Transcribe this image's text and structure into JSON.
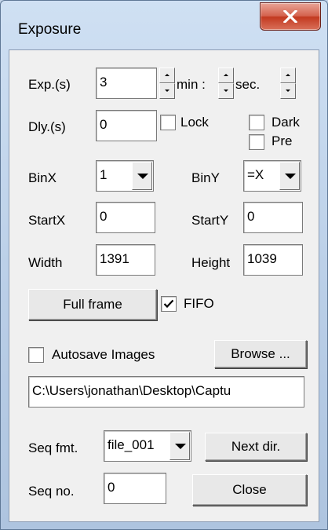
{
  "window": {
    "title": "Exposure",
    "close_glyph": "X"
  },
  "exposure": {
    "label": "Exp.(s)",
    "value": "3",
    "min_label": "min :",
    "sec_label": "sec."
  },
  "delay": {
    "label": "Dly.(s)",
    "value": "0"
  },
  "lock": {
    "label": "Lock",
    "checked": false
  },
  "dark": {
    "label": "Dark",
    "checked": false
  },
  "pre": {
    "label": "Pre",
    "checked": false
  },
  "binx": {
    "label": "BinX",
    "value": "1"
  },
  "biny": {
    "label": "BinY",
    "value": "=X"
  },
  "startx": {
    "label": "StartX",
    "value": "0"
  },
  "starty": {
    "label": "StartY",
    "value": "0"
  },
  "width": {
    "label": "Width",
    "value": "1391"
  },
  "height": {
    "label": "Height",
    "value": "1039"
  },
  "full_frame_button": "Full frame",
  "fifo": {
    "label": "FIFO",
    "checked": true
  },
  "autosave": {
    "label": "Autosave Images",
    "checked": false
  },
  "browse_button": "Browse ...",
  "path": {
    "value": "C:\\Users\\jonathan\\Desktop\\Captu"
  },
  "seq_fmt": {
    "label": "Seq fmt.",
    "value": "file_001"
  },
  "next_dir_button": "Next dir.",
  "seq_no": {
    "label": "Seq no.",
    "value": "0"
  },
  "close_button": "Close",
  "colors": {
    "titlebar": "#c4d5ea",
    "client_bg": "#f0f0f0",
    "close_red": "#c2391f"
  },
  "icons": {
    "close": "close-x-icon",
    "spin_up": "spin-up-arrow-icon",
    "spin_down": "spin-down-arrow-icon",
    "dropdown": "dropdown-arrow-icon",
    "check": "checkmark-icon"
  }
}
